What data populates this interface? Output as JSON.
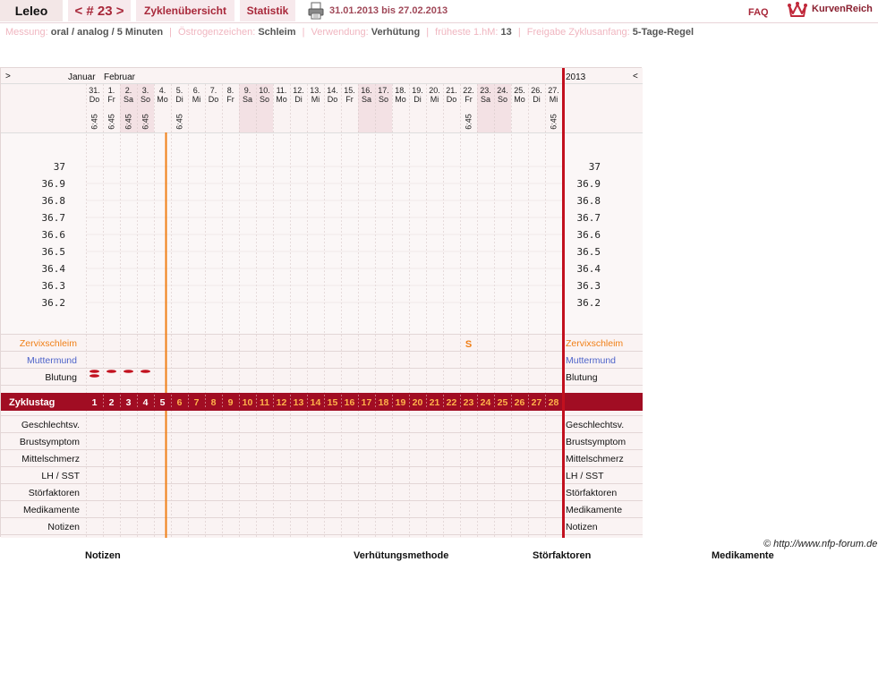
{
  "topbar": {
    "user": "Leleo",
    "cycle_nav": "< # 23 >",
    "overview_tab": "Zyklenübersicht",
    "stats_tab": "Statistik",
    "print_icon": "printer-icon",
    "date_range": "31.01.2013 bis 27.02.2013",
    "faq": "FAQ",
    "logo_icon": "kurvenreich-crown-icon",
    "brand": "KurvenReich"
  },
  "info": [
    {
      "label": "Messung:",
      "value": "oral / analog / 5 Minuten"
    },
    {
      "label": "Östrogenzeichen:",
      "value": "Schleim"
    },
    {
      "label": "Verwendung:",
      "value": "Verhütung"
    },
    {
      "label": "früheste 1.hM:",
      "value": "13"
    },
    {
      "label": "Freigabe Zyklusanfang:",
      "value": "5-Tage-Regel"
    }
  ],
  "chart": {
    "nav_prev": ">",
    "nav_next": "<",
    "year": "2013",
    "months": [
      "Januar",
      "Februar"
    ],
    "days": [
      {
        "date": "31.",
        "wd": "Do",
        "time": "6:45"
      },
      {
        "date": "1.",
        "wd": "Fr",
        "time": "6:45"
      },
      {
        "date": "2.",
        "wd": "Sa",
        "time": "6:45"
      },
      {
        "date": "3.",
        "wd": "So",
        "time": "6:45"
      },
      {
        "date": "4.",
        "wd": "Mo",
        "time": ""
      },
      {
        "date": "5.",
        "wd": "Di",
        "time": "6:45"
      },
      {
        "date": "6.",
        "wd": "Mi",
        "time": ""
      },
      {
        "date": "7.",
        "wd": "Do",
        "time": ""
      },
      {
        "date": "8.",
        "wd": "Fr",
        "time": ""
      },
      {
        "date": "9.",
        "wd": "Sa",
        "time": ""
      },
      {
        "date": "10.",
        "wd": "So",
        "time": ""
      },
      {
        "date": "11.",
        "wd": "Mo",
        "time": ""
      },
      {
        "date": "12.",
        "wd": "Di",
        "time": ""
      },
      {
        "date": "13.",
        "wd": "Mi",
        "time": ""
      },
      {
        "date": "14.",
        "wd": "Do",
        "time": ""
      },
      {
        "date": "15.",
        "wd": "Fr",
        "time": ""
      },
      {
        "date": "16.",
        "wd": "Sa",
        "time": ""
      },
      {
        "date": "17.",
        "wd": "So",
        "time": ""
      },
      {
        "date": "18.",
        "wd": "Mo",
        "time": ""
      },
      {
        "date": "19.",
        "wd": "Di",
        "time": ""
      },
      {
        "date": "20.",
        "wd": "Mi",
        "time": ""
      },
      {
        "date": "21.",
        "wd": "Do",
        "time": ""
      },
      {
        "date": "22.",
        "wd": "Fr",
        "time": "6:45"
      },
      {
        "date": "23.",
        "wd": "Sa",
        "time": ""
      },
      {
        "date": "24.",
        "wd": "So",
        "time": ""
      },
      {
        "date": "25.",
        "wd": "Mo",
        "time": ""
      },
      {
        "date": "26.",
        "wd": "Di",
        "time": ""
      },
      {
        "date": "27.",
        "wd": "Mi",
        "time": "6:45"
      }
    ],
    "temperature_axis": [
      "37",
      "36.9",
      "36.8",
      "36.7",
      "36.6",
      "36.5",
      "36.4",
      "36.3",
      "36.2"
    ],
    "cervix_mucus": {
      "label": "Zervixschleim",
      "entries": [
        {
          "day": 23,
          "symbol": "S"
        }
      ]
    },
    "cervix_os": {
      "label": "Muttermund"
    },
    "bleeding": {
      "label": "Blutung",
      "days": [
        1,
        2,
        3,
        4
      ],
      "strong_days": [
        1
      ]
    },
    "cycle_day": {
      "label": "Zyklustag",
      "count": 28,
      "bleeding_until": 5
    },
    "cycle_day_numbers": [
      "1",
      "2",
      "3",
      "4",
      "5",
      "6",
      "7",
      "8",
      "9",
      "10",
      "11",
      "12",
      "13",
      "14",
      "15",
      "16",
      "17",
      "18",
      "19",
      "20",
      "21",
      "22",
      "23",
      "24",
      "25",
      "26",
      "27",
      "28"
    ],
    "rows": [
      "Geschlechtsv.",
      "Brustsymptom",
      "Mittelschmerz",
      "LH / SST",
      "Störfaktoren",
      "Medikamente",
      "Notizen"
    ],
    "marker_day": 5
  },
  "colors": {
    "accent": "#a8283a",
    "orange": "#f07f16",
    "blue": "#4d63c9",
    "zyklus_bg": "#a10d23"
  },
  "footer": {
    "credit": "© http://www.nfp-forum.de",
    "col1": "Notizen",
    "col2": "Verhütungsmethode",
    "col3": "Störfaktoren",
    "col4": "Medikamente"
  }
}
